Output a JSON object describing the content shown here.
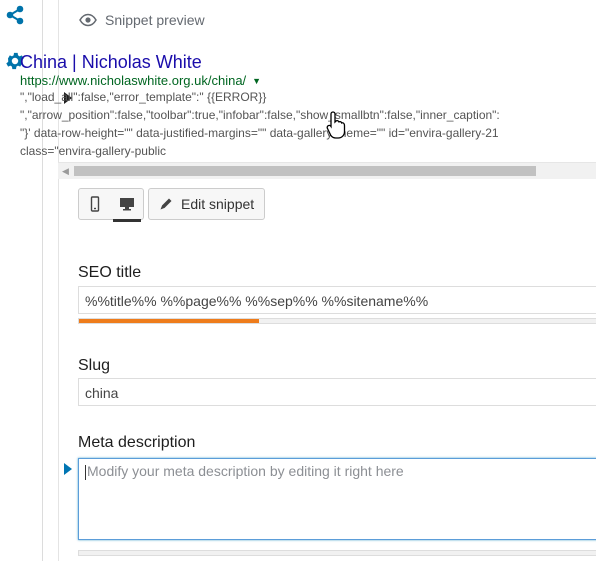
{
  "sidebar": {
    "icons": [
      "share-icon",
      "gear-icon"
    ]
  },
  "preview": {
    "header_label": "Snippet preview",
    "serp_title": "China | Nicholas White",
    "serp_url": "https://www.nicholaswhite.org.uk/china/",
    "serp_lines": [
      "\",\"load_all\":false,\"error_template\":\" {{ERROR}}",
      "\",\"arrow_position\":false,\"toolbar\":true,\"infobar\":false,\"show_smallbtn\":false,\"inner_caption\":",
      "\"}' data-row-height=\"\" data-justified-margins=\"\" data-gallery-theme=\"\" id=\"envira-gallery-21",
      "class=\"envira-gallery-public"
    ]
  },
  "toolbar": {
    "mobile_icon": "mobile-icon",
    "desktop_icon": "desktop-icon",
    "edit_snippet_label": "Edit snippet",
    "edit_icon": "pencil-icon"
  },
  "seo_title": {
    "label": "SEO title",
    "value": "%%title%% %%page%% %%sep%% %%sitename%%",
    "progress_fraction": 0.34,
    "progress_color": "#ee7c1b"
  },
  "slug": {
    "label": "Slug",
    "value": "china"
  },
  "meta_description": {
    "label": "Meta description",
    "placeholder": "Modify your meta description by editing it right here",
    "value": ""
  }
}
